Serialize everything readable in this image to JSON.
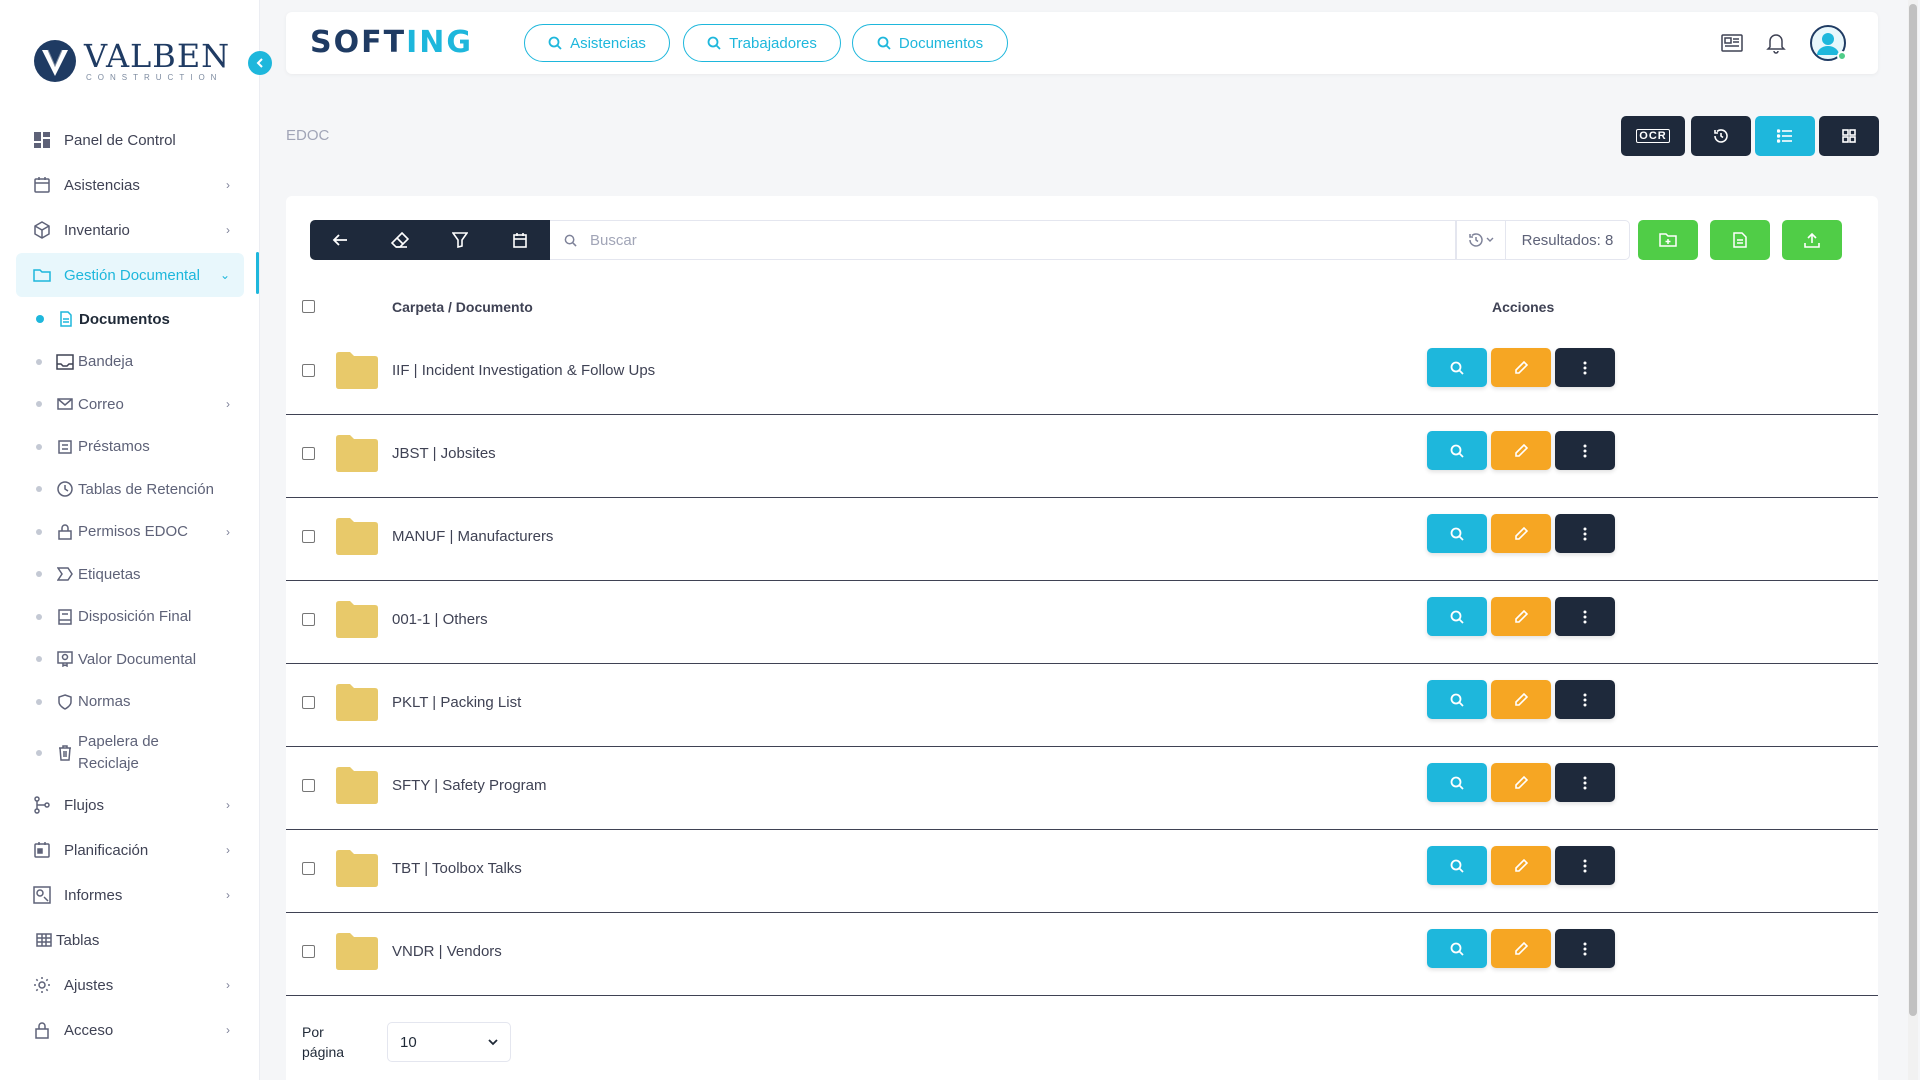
{
  "sidebar": {
    "logo_name": "VALBEN",
    "logo_sub": "CONSTRUCTION",
    "items_top": [
      {
        "label": "Panel de Control",
        "icon": "dashboard-icon"
      },
      {
        "label": "Asistencias",
        "icon": "calendar-icon"
      },
      {
        "label": "Inventario",
        "icon": "box-icon"
      },
      {
        "label": "Gestión Documental",
        "icon": "folder-icon"
      }
    ],
    "sub_items": [
      {
        "label": "Documentos",
        "icon": "document-icon"
      },
      {
        "label": "Bandeja",
        "icon": "inbox-icon"
      },
      {
        "label": "Correo",
        "icon": "mail-icon"
      },
      {
        "label": "Préstamos",
        "icon": "loan-icon"
      },
      {
        "label": "Tablas de Retención",
        "icon": "clock-icon"
      },
      {
        "label": "Permisos EDOC",
        "icon": "lock-icon"
      },
      {
        "label": "Etiquetas",
        "icon": "tag-icon"
      },
      {
        "label": "Disposición Final",
        "icon": "archive-icon"
      },
      {
        "label": "Valor Documental",
        "icon": "certificate-icon"
      },
      {
        "label": "Normas",
        "icon": "shield-icon"
      },
      {
        "label": "Papelera de Reciclaje",
        "icon": "trash-icon"
      }
    ],
    "items_bottom": [
      {
        "label": "Flujos",
        "icon": "flow-icon"
      },
      {
        "label": "Planificación",
        "icon": "calendar-check-icon"
      },
      {
        "label": "Informes",
        "icon": "report-icon"
      },
      {
        "label": "Tablas",
        "icon": "table-icon"
      },
      {
        "label": "Ajustes",
        "icon": "gear-icon"
      },
      {
        "label": "Acceso",
        "icon": "lock-icon"
      }
    ]
  },
  "topbar": {
    "brand_a": "S",
    "brand_o": "O",
    "brand_b": "FT",
    "brand_c": "ING",
    "pills": [
      "Asistencias",
      "Trabajadores",
      "Documentos"
    ]
  },
  "breadcrumb": "EDOC",
  "view_buttons": {
    "ocr_label": "OCR"
  },
  "toolbar": {
    "search_placeholder": "Buscar",
    "results": "Resultados: 8"
  },
  "table": {
    "col_name": "Carpeta / Documento",
    "col_actions": "Acciones",
    "rows": [
      {
        "name": "IIF | Incident Investigation & Follow Ups"
      },
      {
        "name": "JBST | Jobsites"
      },
      {
        "name": "MANUF | Manufacturers"
      },
      {
        "name": "001-1 | Others"
      },
      {
        "name": "PKLT | Packing List"
      },
      {
        "name": "SFTY | Safety Program"
      },
      {
        "name": "TBT | Toolbox Talks"
      },
      {
        "name": "VNDR | Vendors"
      }
    ]
  },
  "pagination": {
    "label_line1": "Por",
    "label_line2": "página",
    "per_page": "10"
  },
  "colors": {
    "accent": "#1eb7dc",
    "dark": "#1e293b",
    "edit": "#f6a623",
    "success": "#50cd47",
    "folder": "#e8c96a"
  }
}
